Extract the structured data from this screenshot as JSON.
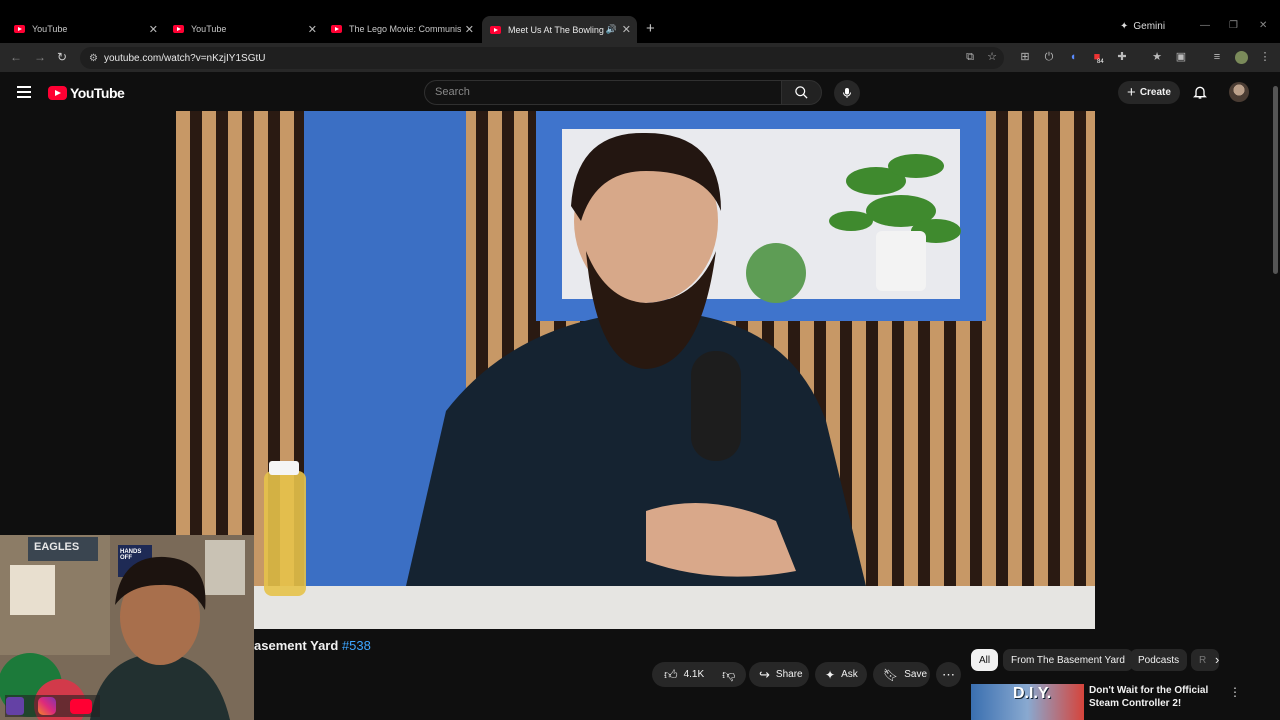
{
  "browser": {
    "tabs": [
      {
        "label": "YouTube",
        "active": false
      },
      {
        "label": "YouTube",
        "active": false
      },
      {
        "label": "The Lego Movie: Communist Pr",
        "active": false
      },
      {
        "label": "Meet Us At The Bowling All",
        "active": true,
        "audio": true
      }
    ],
    "gemini_label": "Gemini",
    "url": "youtube.com/watch?v=nKzjIY1SGtU",
    "extension_badge": "84"
  },
  "header": {
    "logo_text": "YouTube",
    "search_placeholder": "Search",
    "create_label": "Create"
  },
  "video": {
    "title_visible": "asement Yard",
    "episode_tag": "#538",
    "actions": {
      "like_count": "4.1K",
      "share_label": "Share",
      "ask_label": "Ask",
      "save_label": "Save"
    }
  },
  "sidebar": {
    "chips": [
      "All",
      "From The Basement Yard",
      "Podcasts",
      "R"
    ],
    "recommendation": {
      "thumb_text": "D.I.Y.",
      "title": "Don't Wait for the Official Steam Controller 2!"
    }
  },
  "overlay": {
    "webcam_sign_1": "EAGLES",
    "webcam_sign_2": "HANDS OFF"
  },
  "colors": {
    "brand_red": "#ff0033",
    "link_blue": "#3ea6ff",
    "background": "#0f0f0f",
    "pill": "#272727"
  }
}
